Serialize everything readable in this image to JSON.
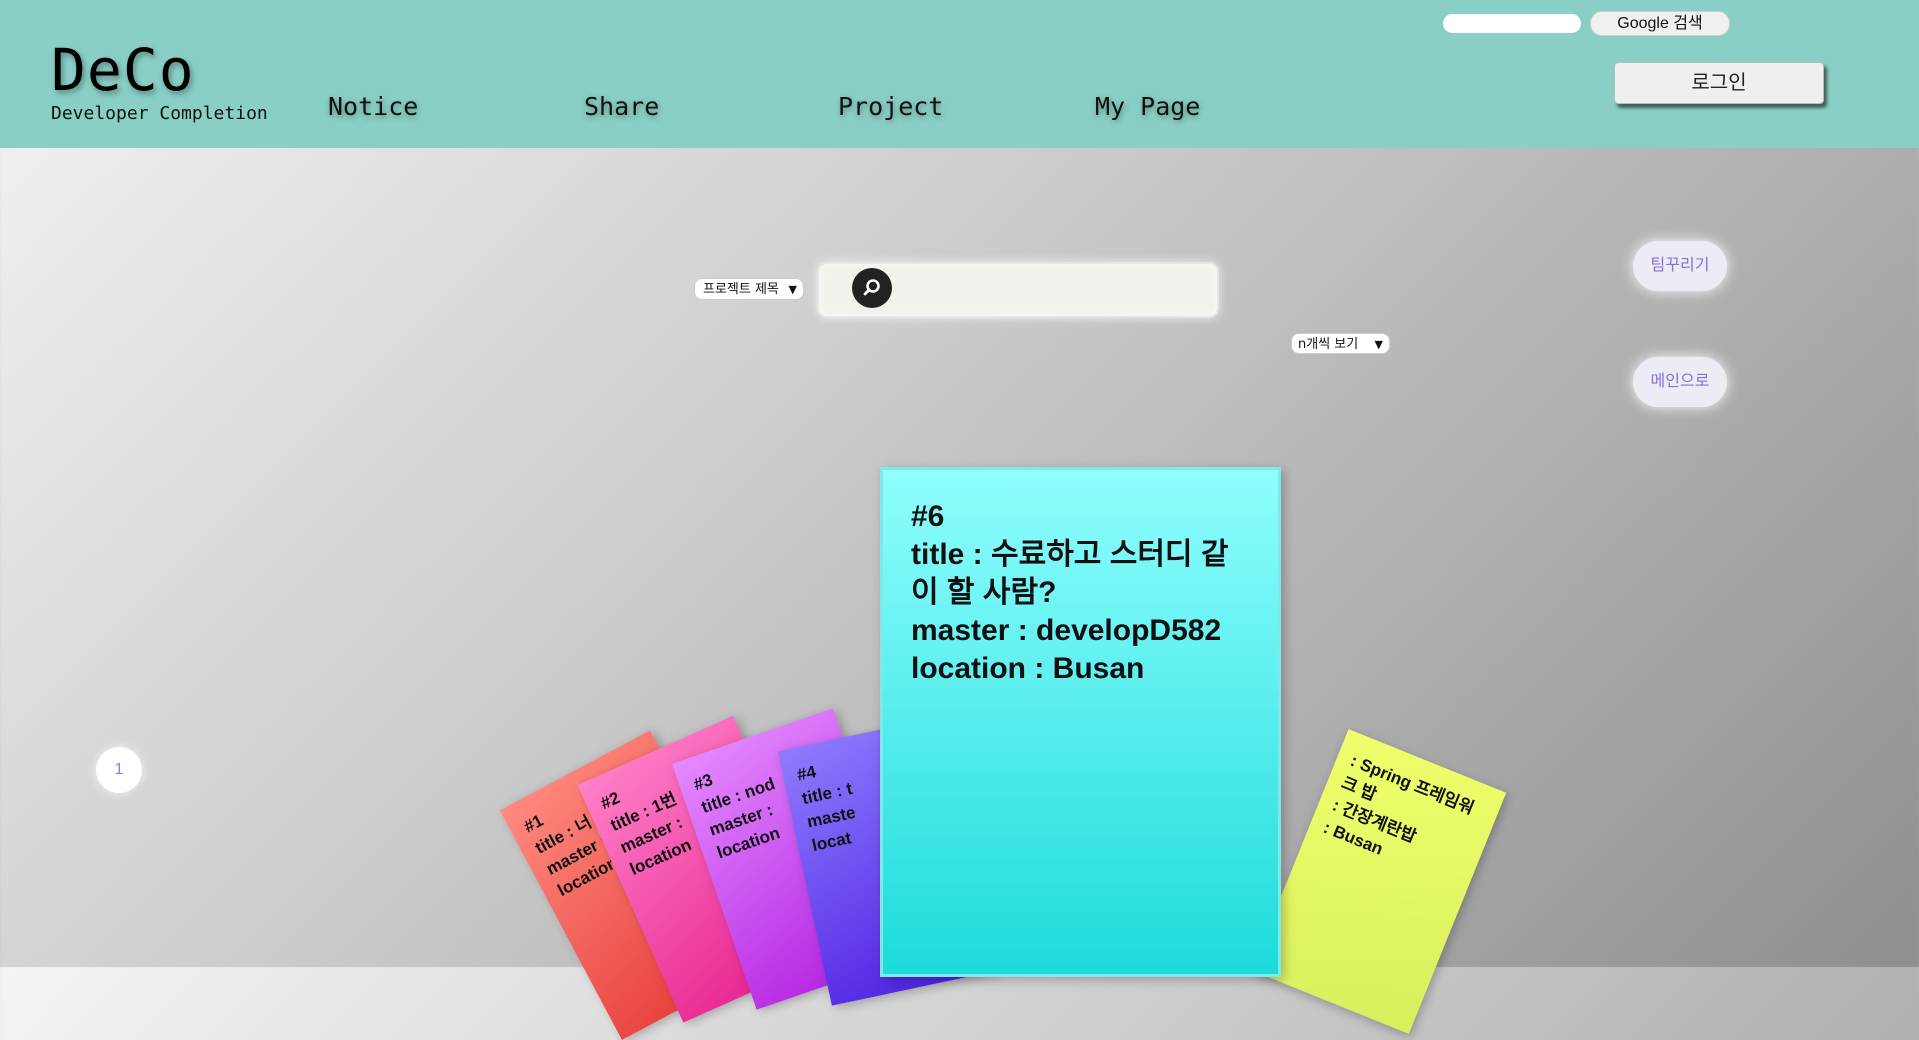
{
  "header": {
    "logo": "DeCo",
    "logo_sub": "Developer Completion",
    "nav": [
      {
        "label": "Notice"
      },
      {
        "label": "Share"
      },
      {
        "label": "Project"
      },
      {
        "label": "My Page"
      }
    ],
    "google_search_button": "Google 검색",
    "login_button": "로그인"
  },
  "search": {
    "field_select": "프로젝트 제목",
    "query": "",
    "per_page_select": "n개씩 보기"
  },
  "side_buttons": {
    "team_button": "팀꾸리기",
    "main_button": "메인으로"
  },
  "pagination": {
    "current": "1"
  },
  "cards": {
    "featured": {
      "id": "#6",
      "title": "title : 수료하고 스터디 같이 할 사람?",
      "master": "master : developD582",
      "location": "location : Busan"
    },
    "stack": [
      {
        "id": "#1",
        "title": "title : 너 내",
        "master": "master :",
        "location": "location"
      },
      {
        "id": "#2",
        "title": "title : 1번",
        "master": "master :",
        "location": "location"
      },
      {
        "id": "#3",
        "title": "title : nod",
        "master": "master :",
        "location": "location"
      },
      {
        "id": "#4",
        "title": "title : t",
        "master": "maste",
        "location": "locat"
      },
      {
        "id": "",
        "title": ": Spring 프레임워크 밥",
        "master": ": 간장계란밥",
        "location": ": Busan"
      }
    ]
  }
}
